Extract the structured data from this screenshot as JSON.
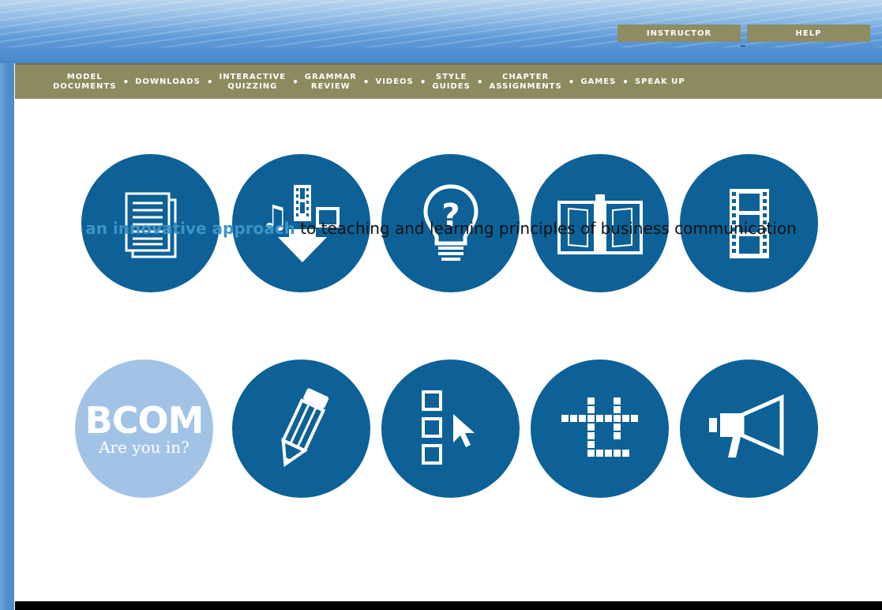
{
  "header": {
    "instructor_label": "INSTRUCTOR",
    "help_label": "HELP"
  },
  "nav": {
    "items": [
      {
        "label": "MODEL\nDOCUMENTS"
      },
      {
        "label": "DOWNLOADS"
      },
      {
        "label": "INTERACTIVE\nQUIZZING"
      },
      {
        "label": "GRAMMAR\nREVIEW"
      },
      {
        "label": "VIDEOS"
      },
      {
        "label": "STYLE\nGUIDES"
      },
      {
        "label": "CHAPTER\nASSIGNMENTS"
      },
      {
        "label": "GAMES"
      },
      {
        "label": "SPEAK UP"
      }
    ],
    "separator": "•"
  },
  "tagline": {
    "accent": "an innovative approach",
    "rest": " to teaching and learning principles of business communication"
  },
  "bcom": {
    "title": "BCOM",
    "subtitle": "Are you in?"
  },
  "tiles": [
    {
      "icon": "document-icon"
    },
    {
      "icon": "download-media-icon"
    },
    {
      "icon": "lightbulb-question-icon"
    },
    {
      "icon": "open-book-icon"
    },
    {
      "icon": "film-strip-icon"
    },
    {
      "icon": "bcom-logo"
    },
    {
      "icon": "pencil-icon"
    },
    {
      "icon": "checklist-cursor-icon"
    },
    {
      "icon": "crossword-icon"
    },
    {
      "icon": "megaphone-icon"
    }
  ],
  "colors": {
    "circle": "#0d6196",
    "circle_light": "#a3c3e6",
    "nav_bg": "#8c8b5f",
    "accent_text": "#3d94c8"
  }
}
